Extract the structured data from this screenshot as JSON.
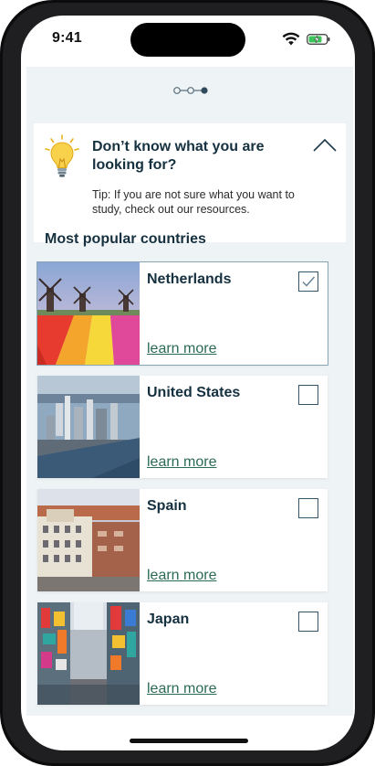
{
  "status_bar": {
    "time": "9:41"
  },
  "stepper": {
    "total_steps": 3,
    "current_step": 3
  },
  "tip": {
    "title": "Don’t know what you are looking for?",
    "text": "Tip: If you are not sure what you want to study, check out our resources."
  },
  "section": {
    "title": "Most popular countries"
  },
  "countries": [
    {
      "name": "Netherlands",
      "link": "learn more",
      "checked": true
    },
    {
      "name": "United States",
      "link": "learn more",
      "checked": false
    },
    {
      "name": "Spain",
      "link": "learn more",
      "checked": false
    },
    {
      "name": "Japan",
      "link": "learn more",
      "checked": false
    }
  ],
  "colors": {
    "accent": "#15303f",
    "link": "#2b6b55",
    "background": "#eef3f5"
  },
  "icons": {
    "tip": "lightbulb-icon",
    "collapse": "chevron-up-icon",
    "checkbox_checked": "checkmark-icon"
  }
}
